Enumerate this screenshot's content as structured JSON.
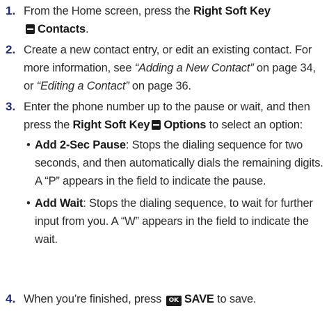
{
  "steps": [
    {
      "number": "1.",
      "pre": "From the Home screen, press the ",
      "key": "Right Soft Key",
      "action": "Contacts",
      "post": "."
    },
    {
      "number": "2.",
      "text1": "Create a new contact entry, or edit an existing contact. For more information, see ",
      "link1": "“Adding a New Contact”",
      "text2": " on page 34, or ",
      "link2": "“Editing a Contact”",
      "text3": " on page 36."
    },
    {
      "number": "3.",
      "pre": "Enter the phone number up to the pause or wait, and then press the ",
      "key": "Right Soft Key",
      "action": "Options",
      "post": " to select an option:",
      "bullets": [
        {
          "label": "Add 2-Sec Pause",
          "text": ": Stops the dialing sequence for two seconds, and then automatically dials the remaining digits. A “P” appears in the field to indicate the pause."
        },
        {
          "label": "Add Wait",
          "text": ": Stops the dialing sequence, to wait for further input from you. A “W” appears in the field to indicate the wait."
        }
      ]
    },
    {
      "number": "4.",
      "pre": "When you’re finished, press ",
      "ok_key": "OK",
      "action": "SAVE",
      "post": " to save."
    }
  ],
  "bullet_glyph": "•"
}
